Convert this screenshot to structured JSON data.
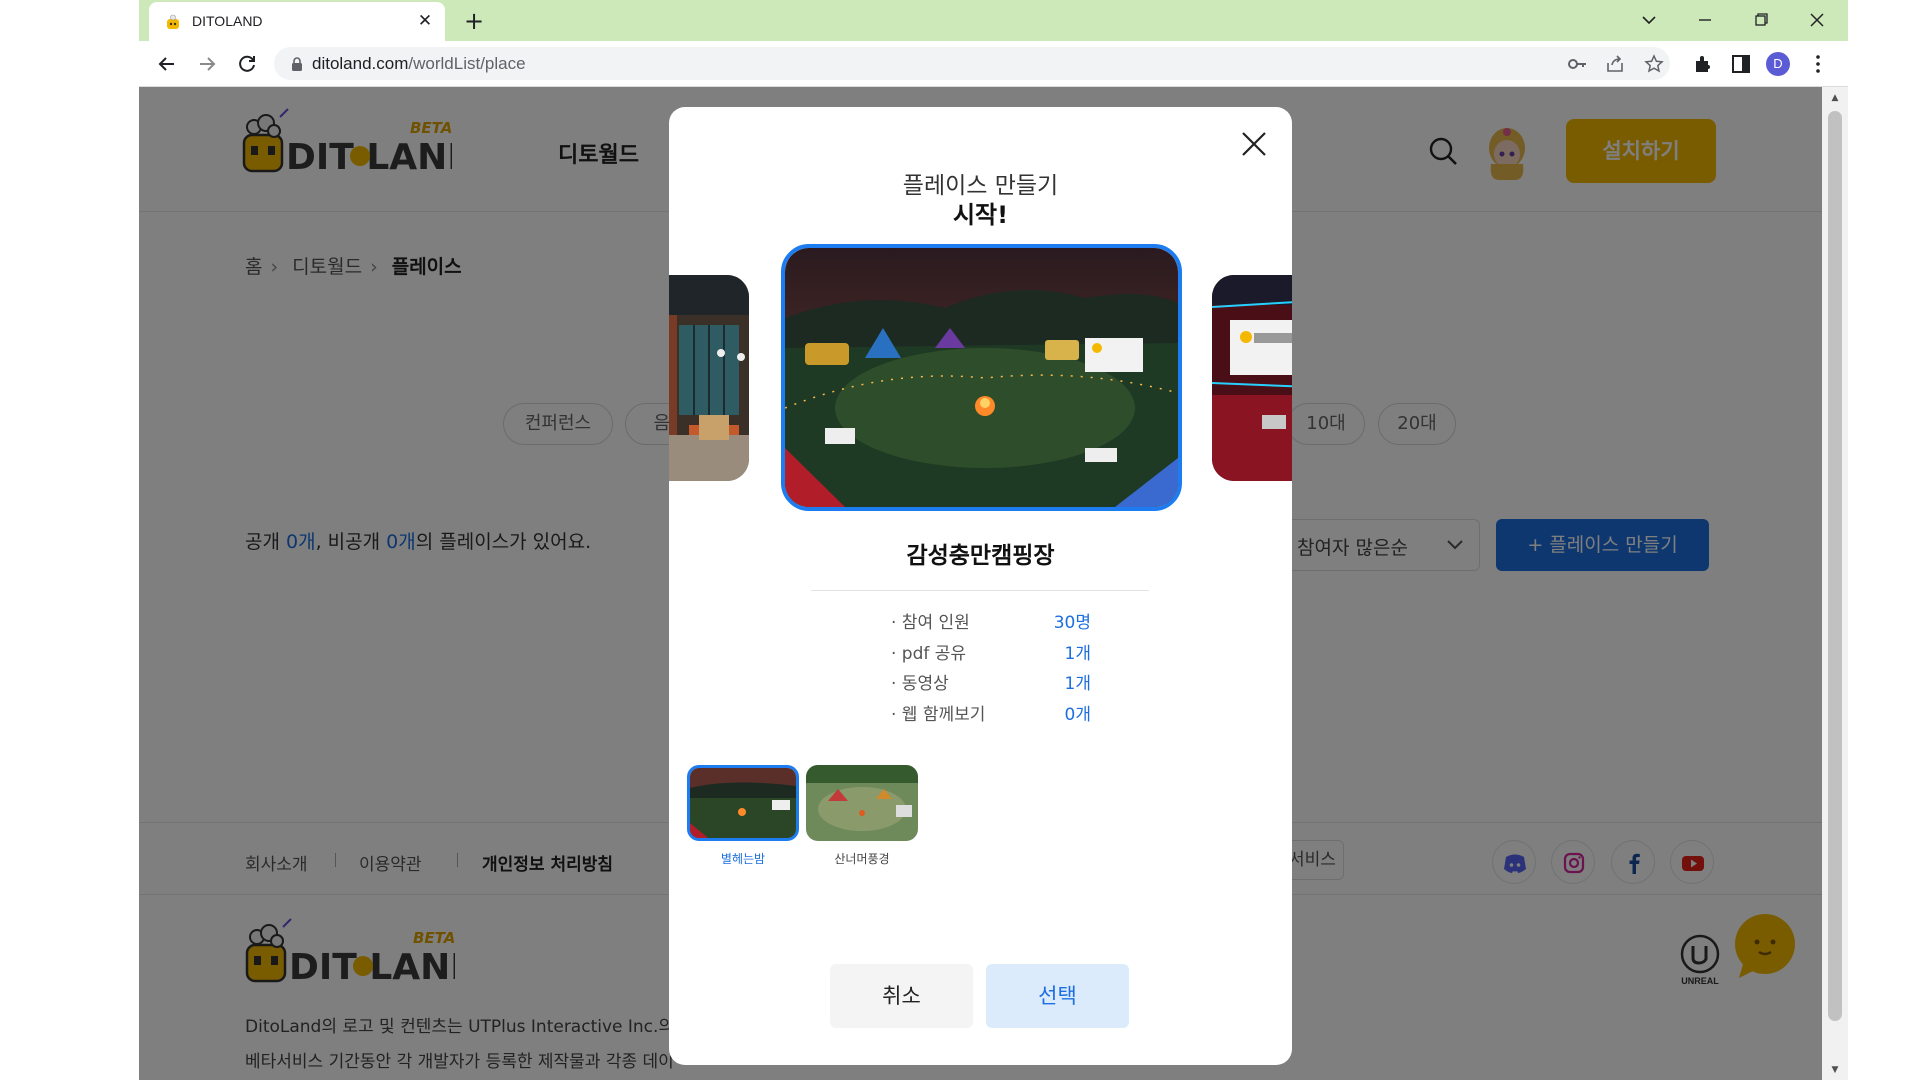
{
  "browser": {
    "tab_title": "DITOLAND",
    "tab_close": "✕",
    "new_tab": "+",
    "url_host": "ditoland.com",
    "url_path": "/worldList/place",
    "profile_initial": "D"
  },
  "header": {
    "logo_text": "DIT LAND",
    "logo_badge": "BETA",
    "nav_item": "디토월드",
    "install_label": "설치하기"
  },
  "breadcrumb": [
    "홈",
    "디토월드",
    "플레이스"
  ],
  "filters": [
    "컨퍼런스",
    "음악",
    "10대",
    "20대"
  ],
  "summary": {
    "prefix": "공개 ",
    "public_count": "0개",
    "middle": ", 비공개 ",
    "private_count": "0개",
    "suffix": "의 플레이스가 있어요."
  },
  "sort": {
    "selected": "참여자 많은순"
  },
  "create_button": "+ 플레이스 만들기",
  "footer": {
    "links": [
      "회사소개",
      "이용약관",
      "개인정보 처리방침"
    ],
    "service_label": "서비스",
    "social": [
      "discord-icon",
      "instagram-icon",
      "facebook-icon",
      "youtube-icon"
    ],
    "text_line1": "DitoLand의 로고 및 컨텐츠는 UTPlus Interactive Inc.의",
    "text_line2": "베타서비스 기간동안 각 개발자가 등록한 제작물과 각종 데이",
    "unreal_label": "UNREAL"
  },
  "modal": {
    "title_line1": "플레이스 만들기",
    "title_line2": "시작!",
    "place_name": "감성충만캠핑장",
    "stats": [
      {
        "label": "· 참여 인원",
        "value": "30명"
      },
      {
        "label": "· pdf 공유",
        "value": "1개"
      },
      {
        "label": "· 동영상",
        "value": "1개"
      },
      {
        "label": "· 웹 함께보기",
        "value": "0개"
      }
    ],
    "variants": [
      {
        "label": "별헤는밤",
        "selected": true
      },
      {
        "label": "산너머풍경",
        "selected": false
      }
    ],
    "cancel_label": "취소",
    "select_label": "선택"
  },
  "colors": {
    "accent_blue": "#1c6fe0",
    "install_yellow": "#f5b800",
    "tabstrip_green": "#cde8b9"
  }
}
